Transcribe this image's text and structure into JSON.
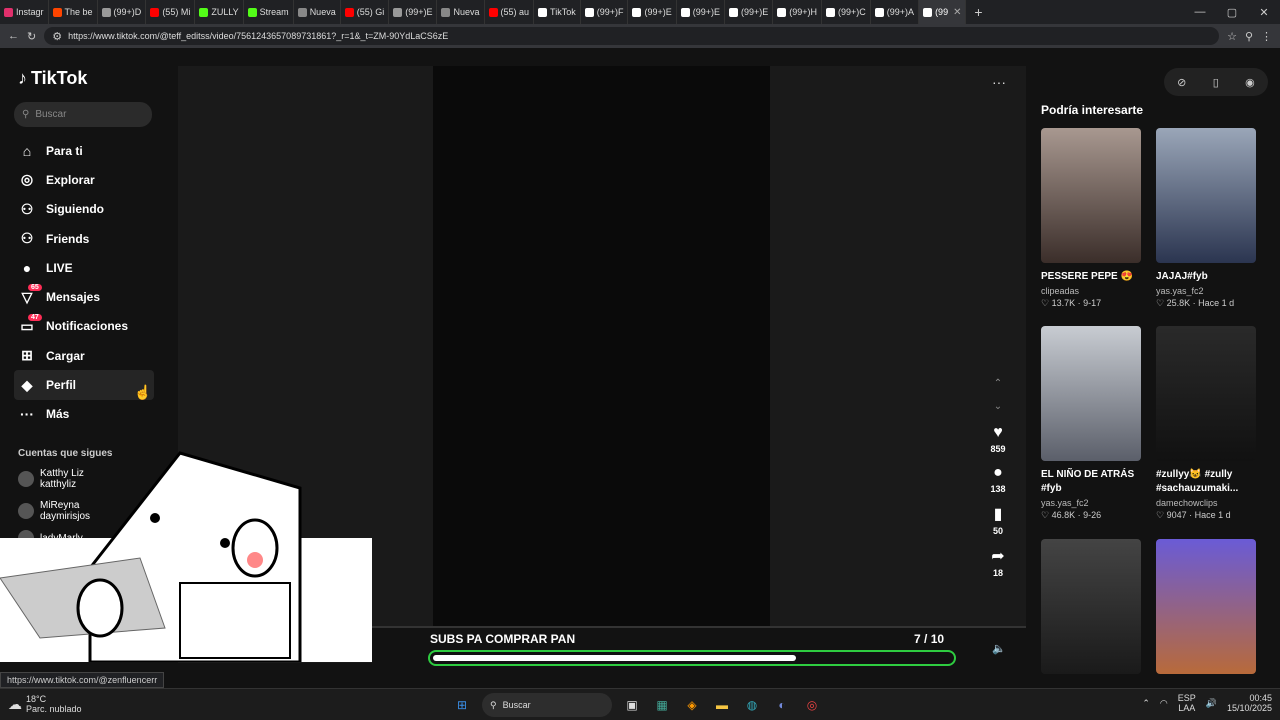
{
  "browser": {
    "tabs": [
      {
        "label": "Instagr",
        "color": "#e1306c"
      },
      {
        "label": "The be",
        "color": "#ff4500"
      },
      {
        "label": "(99+)D",
        "color": "#999999"
      },
      {
        "label": "(55) Mi",
        "color": "#ff0000"
      },
      {
        "label": "ZULLY",
        "color": "#53fc18"
      },
      {
        "label": "Stream",
        "color": "#53fc18"
      },
      {
        "label": "Nueva",
        "color": "#888888"
      },
      {
        "label": "(55) Gi",
        "color": "#ff0000"
      },
      {
        "label": "(99+)E",
        "color": "#999999"
      },
      {
        "label": "Nueva",
        "color": "#888888"
      },
      {
        "label": "(55) au",
        "color": "#ff0000"
      },
      {
        "label": "TikTok",
        "color": "#ffffff"
      },
      {
        "label": "(99+)F",
        "color": "#ffffff"
      },
      {
        "label": "(99+)E",
        "color": "#ffffff"
      },
      {
        "label": "(99+)E",
        "color": "#ffffff"
      },
      {
        "label": "(99+)E",
        "color": "#ffffff"
      },
      {
        "label": "(99+)H",
        "color": "#ffffff"
      },
      {
        "label": "(99+)C",
        "color": "#ffffff"
      },
      {
        "label": "(99+)A",
        "color": "#ffffff"
      },
      {
        "label": "(99",
        "color": "#ffffff",
        "active": true
      }
    ],
    "url": "https://www.tiktok.com/@teff_editss/video/7561243657089731861?_r=1&_t=ZM-90YdLaCS6zE",
    "status_url": "https://www.tiktok.com/@zenfluencerr"
  },
  "sidebar": {
    "logo": "TikTok",
    "search_placeholder": "Buscar",
    "items": [
      {
        "label": "Para ti",
        "icon": "home-icon",
        "glyph": "⌂"
      },
      {
        "label": "Explorar",
        "icon": "compass-icon",
        "glyph": "◎"
      },
      {
        "label": "Siguiendo",
        "icon": "following-icon",
        "glyph": "⚇"
      },
      {
        "label": "Friends",
        "icon": "friends-icon",
        "glyph": "⚇"
      },
      {
        "label": "LIVE",
        "icon": "live-icon",
        "glyph": "●"
      },
      {
        "label": "Mensajes",
        "icon": "message-icon",
        "glyph": "▽",
        "badge": "65"
      },
      {
        "label": "Notificaciones",
        "icon": "inbox-icon",
        "glyph": "▭",
        "badge": "47"
      },
      {
        "label": "Cargar",
        "icon": "upload-icon",
        "glyph": "⊞"
      },
      {
        "label": "Perfil",
        "icon": "profile-icon",
        "glyph": "◆"
      },
      {
        "label": "Más",
        "icon": "more-icon",
        "glyph": "···"
      }
    ],
    "following_title": "Cuentas que sigues",
    "following": [
      {
        "name": "Katthy Liz",
        "handle": "katthyliz"
      },
      {
        "name": "MiReyna",
        "handle": "daymirisjos"
      },
      {
        "name": "ladyMarly",
        "handle": ""
      }
    ]
  },
  "player": {
    "stats": {
      "likes": "859",
      "comments": "138",
      "saves": "50",
      "shares": "18"
    },
    "overlay_title": "SUBS PA COMPRAR PAN",
    "progress_current": "7",
    "progress_total": "/ 10",
    "progress_fraction": 0.7,
    "author": "teff_editss"
  },
  "right_pane": {
    "title": "Podría interesarte",
    "cards": [
      {
        "title": "PESSERE PEPE 😍",
        "user": "clipeadas",
        "likes": "13.7K",
        "date": "9-17"
      },
      {
        "title": "JAJAJ#fyb",
        "user": "yas.yas_fc2",
        "likes": "25.8K",
        "date": "Hace 1 d"
      },
      {
        "title": "EL NIÑO DE ATRÁS #fyb",
        "user": "yas.yas_fc2",
        "likes": "46.8K",
        "date": "9-26"
      },
      {
        "title": "#zullyy😺 #zully #sachauzumaki...",
        "user": "damechowclips",
        "likes": "9047",
        "date": "Hace 1 d"
      },
      {
        "title": "",
        "user": "",
        "likes": "",
        "date": ""
      },
      {
        "title": "",
        "user": "",
        "likes": "",
        "date": ""
      }
    ]
  },
  "taskbar": {
    "temp": "18°C",
    "weather": "Parc. nublado",
    "search": "Buscar",
    "lang": "ESP",
    "region": "LAA",
    "time": "00:45",
    "date": "15/10/2025"
  }
}
